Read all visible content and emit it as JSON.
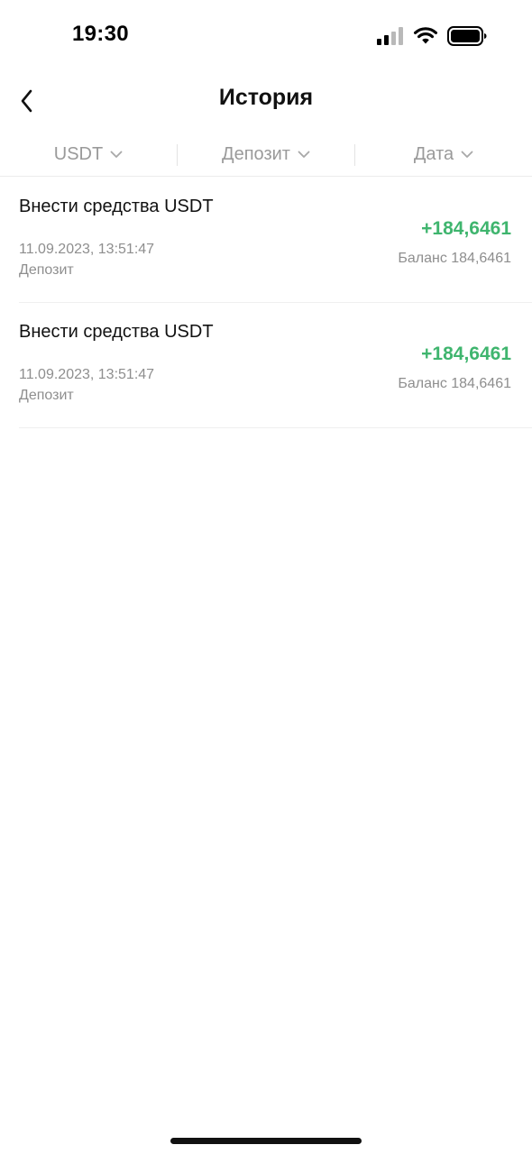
{
  "status_bar": {
    "time": "19:30"
  },
  "header": {
    "title": "История",
    "back_icon": "chevron-left-icon"
  },
  "filters": [
    {
      "label": "USDT",
      "icon": "chevron-down-icon"
    },
    {
      "label": "Депозит",
      "icon": "chevron-down-icon"
    },
    {
      "label": "Дата",
      "icon": "chevron-down-icon"
    }
  ],
  "transactions": [
    {
      "title": "Внести средства USDT",
      "date": "11.09.2023, 13:51:47",
      "type": "Депозит",
      "amount": "+184,6461",
      "balance": "Баланс 184,6461"
    },
    {
      "title": "Внести средства USDT",
      "date": "11.09.2023, 13:51:47",
      "type": "Депозит",
      "amount": "+184,6461",
      "balance": "Баланс 184,6461"
    }
  ],
  "colors": {
    "positive_amount": "#3fb56e",
    "muted_text": "#8e8e8e",
    "filter_text": "#9a9a9a"
  }
}
